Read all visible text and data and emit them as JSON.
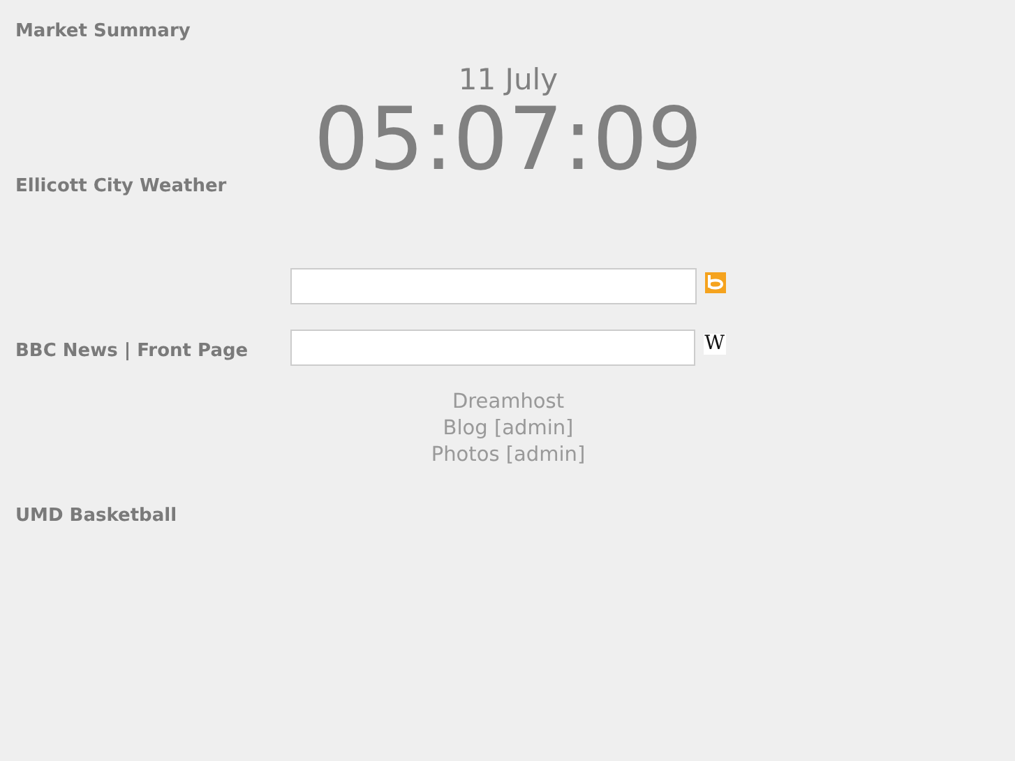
{
  "feeds": [
    {
      "title": "Market Summary"
    },
    {
      "title": "Ellicott City Weather"
    },
    {
      "title": "BBC News | Front Page"
    },
    {
      "title": "UMD Basketball"
    }
  ],
  "clock": {
    "date": "11 July",
    "time": "05:07:09"
  },
  "search_boxes": [
    {
      "kind": "bing"
    },
    {
      "kind": "wiki",
      "glyph": "W"
    }
  ],
  "links": [
    "Dreamhost",
    "Blog [admin]",
    "Photos [admin]"
  ]
}
